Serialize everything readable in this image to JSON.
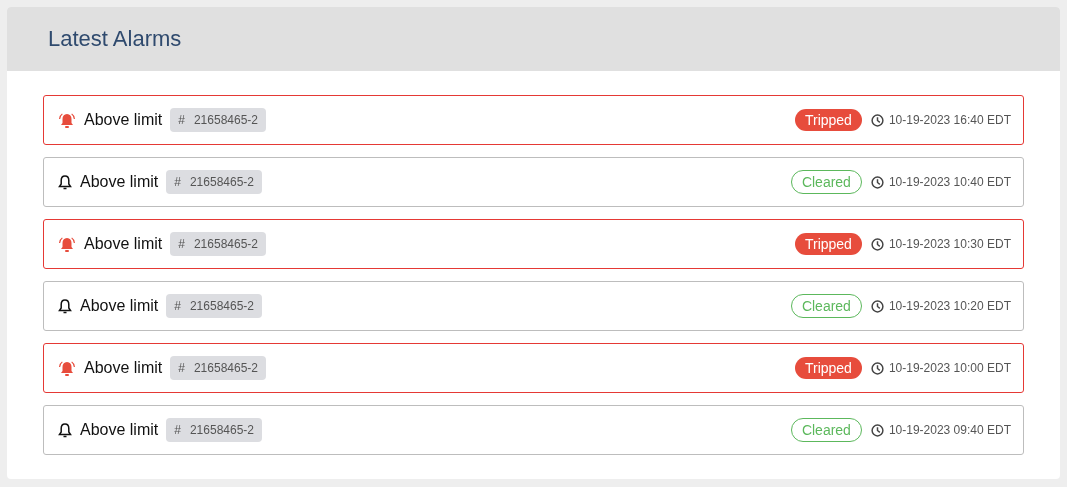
{
  "panel": {
    "title": "Latest Alarms"
  },
  "alarms": [
    {
      "kind": "tripped",
      "label": "Above limit",
      "tag_symbol": "#",
      "tag": "21658465-2",
      "status": "Tripped",
      "time": "10-19-2023 16:40 EDT"
    },
    {
      "kind": "cleared",
      "label": "Above limit",
      "tag_symbol": "#",
      "tag": "21658465-2",
      "status": "Cleared",
      "time": "10-19-2023 10:40 EDT"
    },
    {
      "kind": "tripped",
      "label": "Above limit",
      "tag_symbol": "#",
      "tag": "21658465-2",
      "status": "Tripped",
      "time": "10-19-2023 10:30 EDT"
    },
    {
      "kind": "cleared",
      "label": "Above limit",
      "tag_symbol": "#",
      "tag": "21658465-2",
      "status": "Cleared",
      "time": "10-19-2023 10:20 EDT"
    },
    {
      "kind": "tripped",
      "label": "Above limit",
      "tag_symbol": "#",
      "tag": "21658465-2",
      "status": "Tripped",
      "time": "10-19-2023 10:00 EDT"
    },
    {
      "kind": "cleared",
      "label": "Above limit",
      "tag_symbol": "#",
      "tag": "21658465-2",
      "status": "Cleared",
      "time": "10-19-2023 09:40 EDT"
    }
  ]
}
